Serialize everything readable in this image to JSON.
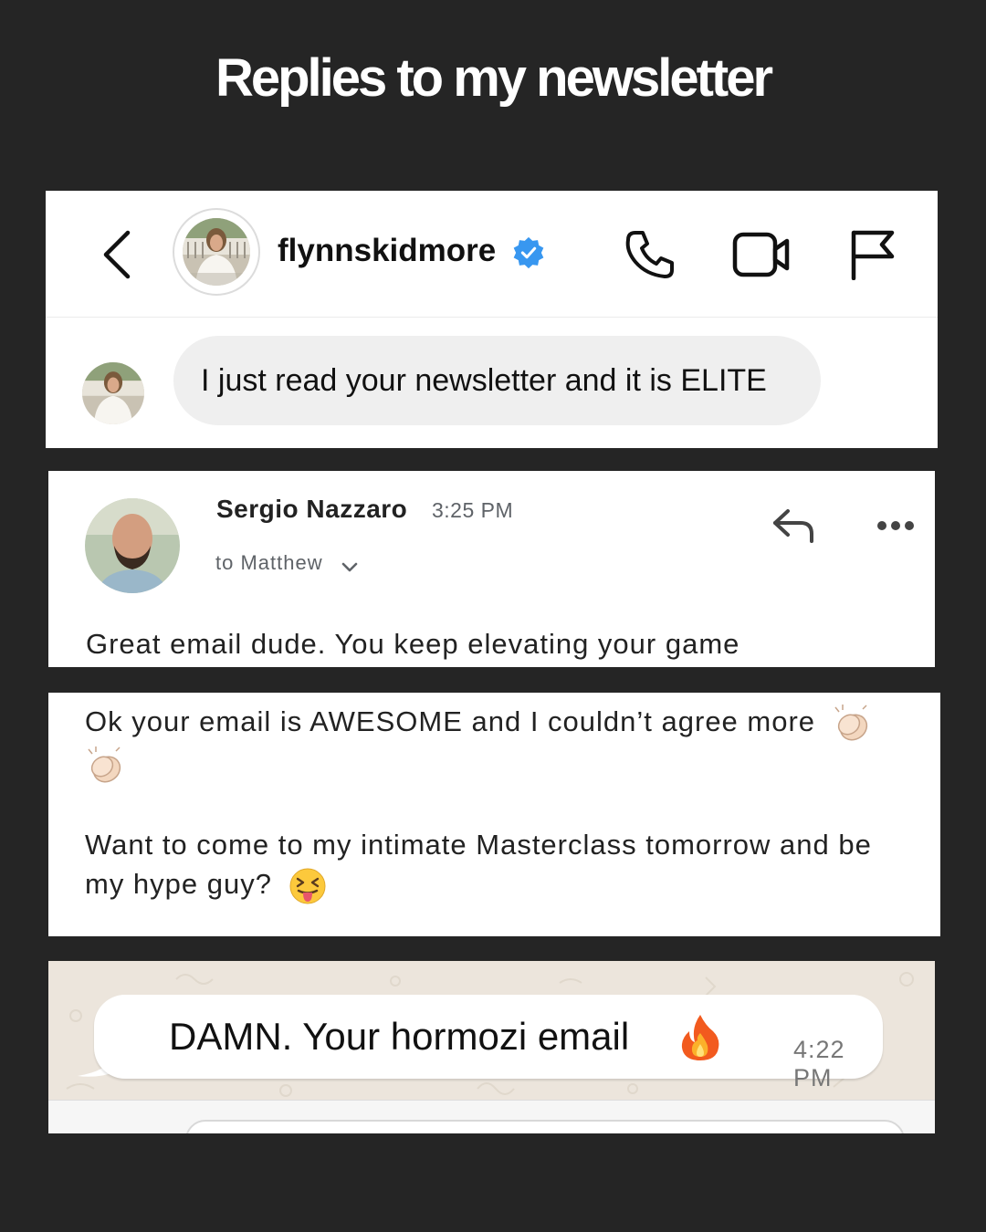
{
  "title": "Replies to my newsletter",
  "instagram": {
    "username": "flynnskidmore",
    "message": "I just read your newsletter and it is ELITE",
    "colors": {
      "verified": "#3897f0",
      "bubble": "#efefef"
    },
    "icons": [
      "back-icon",
      "verified-icon",
      "phone-icon",
      "video-icon",
      "flag-icon"
    ]
  },
  "email": {
    "sender": "Sergio Nazzaro",
    "time": "3:25 PM",
    "to": "to Matthew",
    "body": "Great email dude.  You keep elevating your game",
    "icons": [
      "reply-icon",
      "more-icon",
      "chevron-down-icon"
    ]
  },
  "message": {
    "line1": "Ok your email is AWESOME and I couldn’t agree more",
    "line2": "Want to come to my intimate Masterclass tomorrow and be my hype guy?",
    "icons": [
      "clapping-hands-icon",
      "tongue-out-face-icon"
    ]
  },
  "whatsapp": {
    "text": "DAMN. Your hormozi email",
    "time": "4:22 PM",
    "icons": [
      "fire-icon"
    ]
  }
}
